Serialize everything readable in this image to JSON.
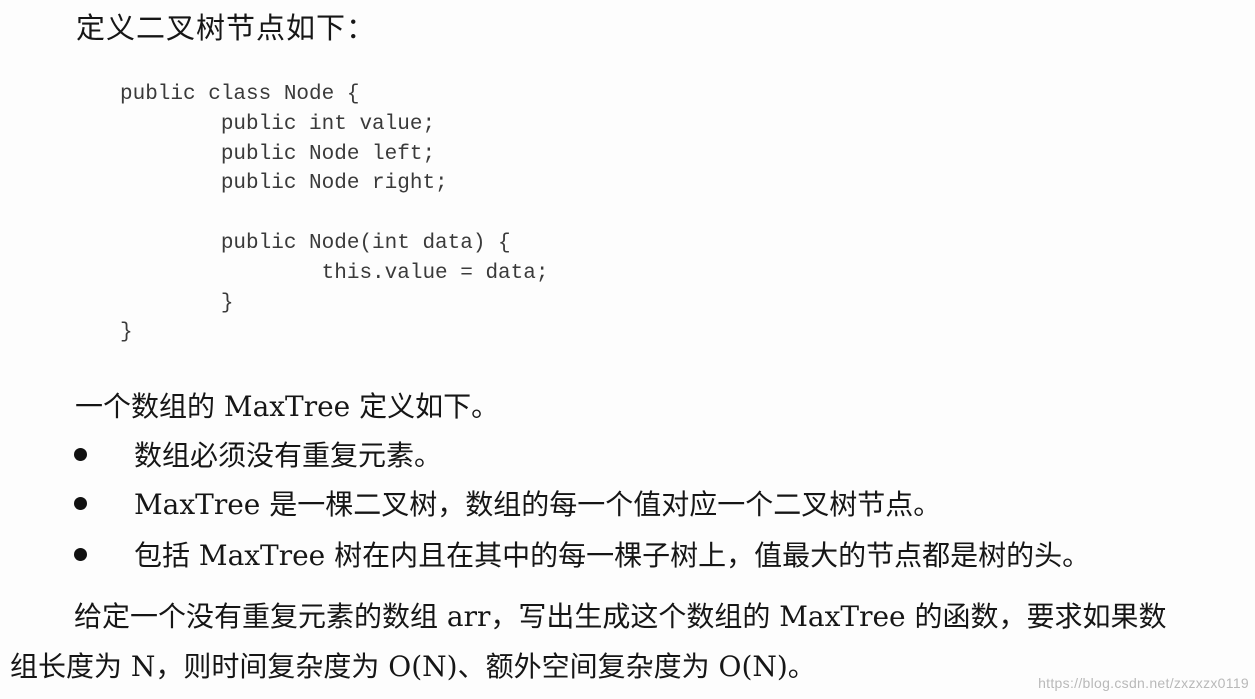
{
  "intro": "定义二叉树节点如下：",
  "code_lines": [
    "public class Node {",
    "        public int value;",
    "        public Node left;",
    "        public Node right;",
    "",
    "        public Node(int data) {",
    "                this.value = data;",
    "        }",
    "}"
  ],
  "definition": "一个数组的 MaxTree 定义如下。",
  "bullets": [
    "数组必须没有重复元素。",
    "MaxTree 是一棵二叉树，数组的每一个值对应一个二叉树节点。",
    "包括 MaxTree 树在内且在其中的每一棵子树上，值最大的节点都是树的头。"
  ],
  "task": {
    "line1": "给定一个没有重复元素的数组 arr，写出生成这个数组的 MaxTree 的函数，要求如果数",
    "line2": "组长度为 N，则时间复杂度为 O(N)、额外空间复杂度为 O(N)。"
  },
  "watermark": "https://blog.csdn.net/zxzxzx0119"
}
